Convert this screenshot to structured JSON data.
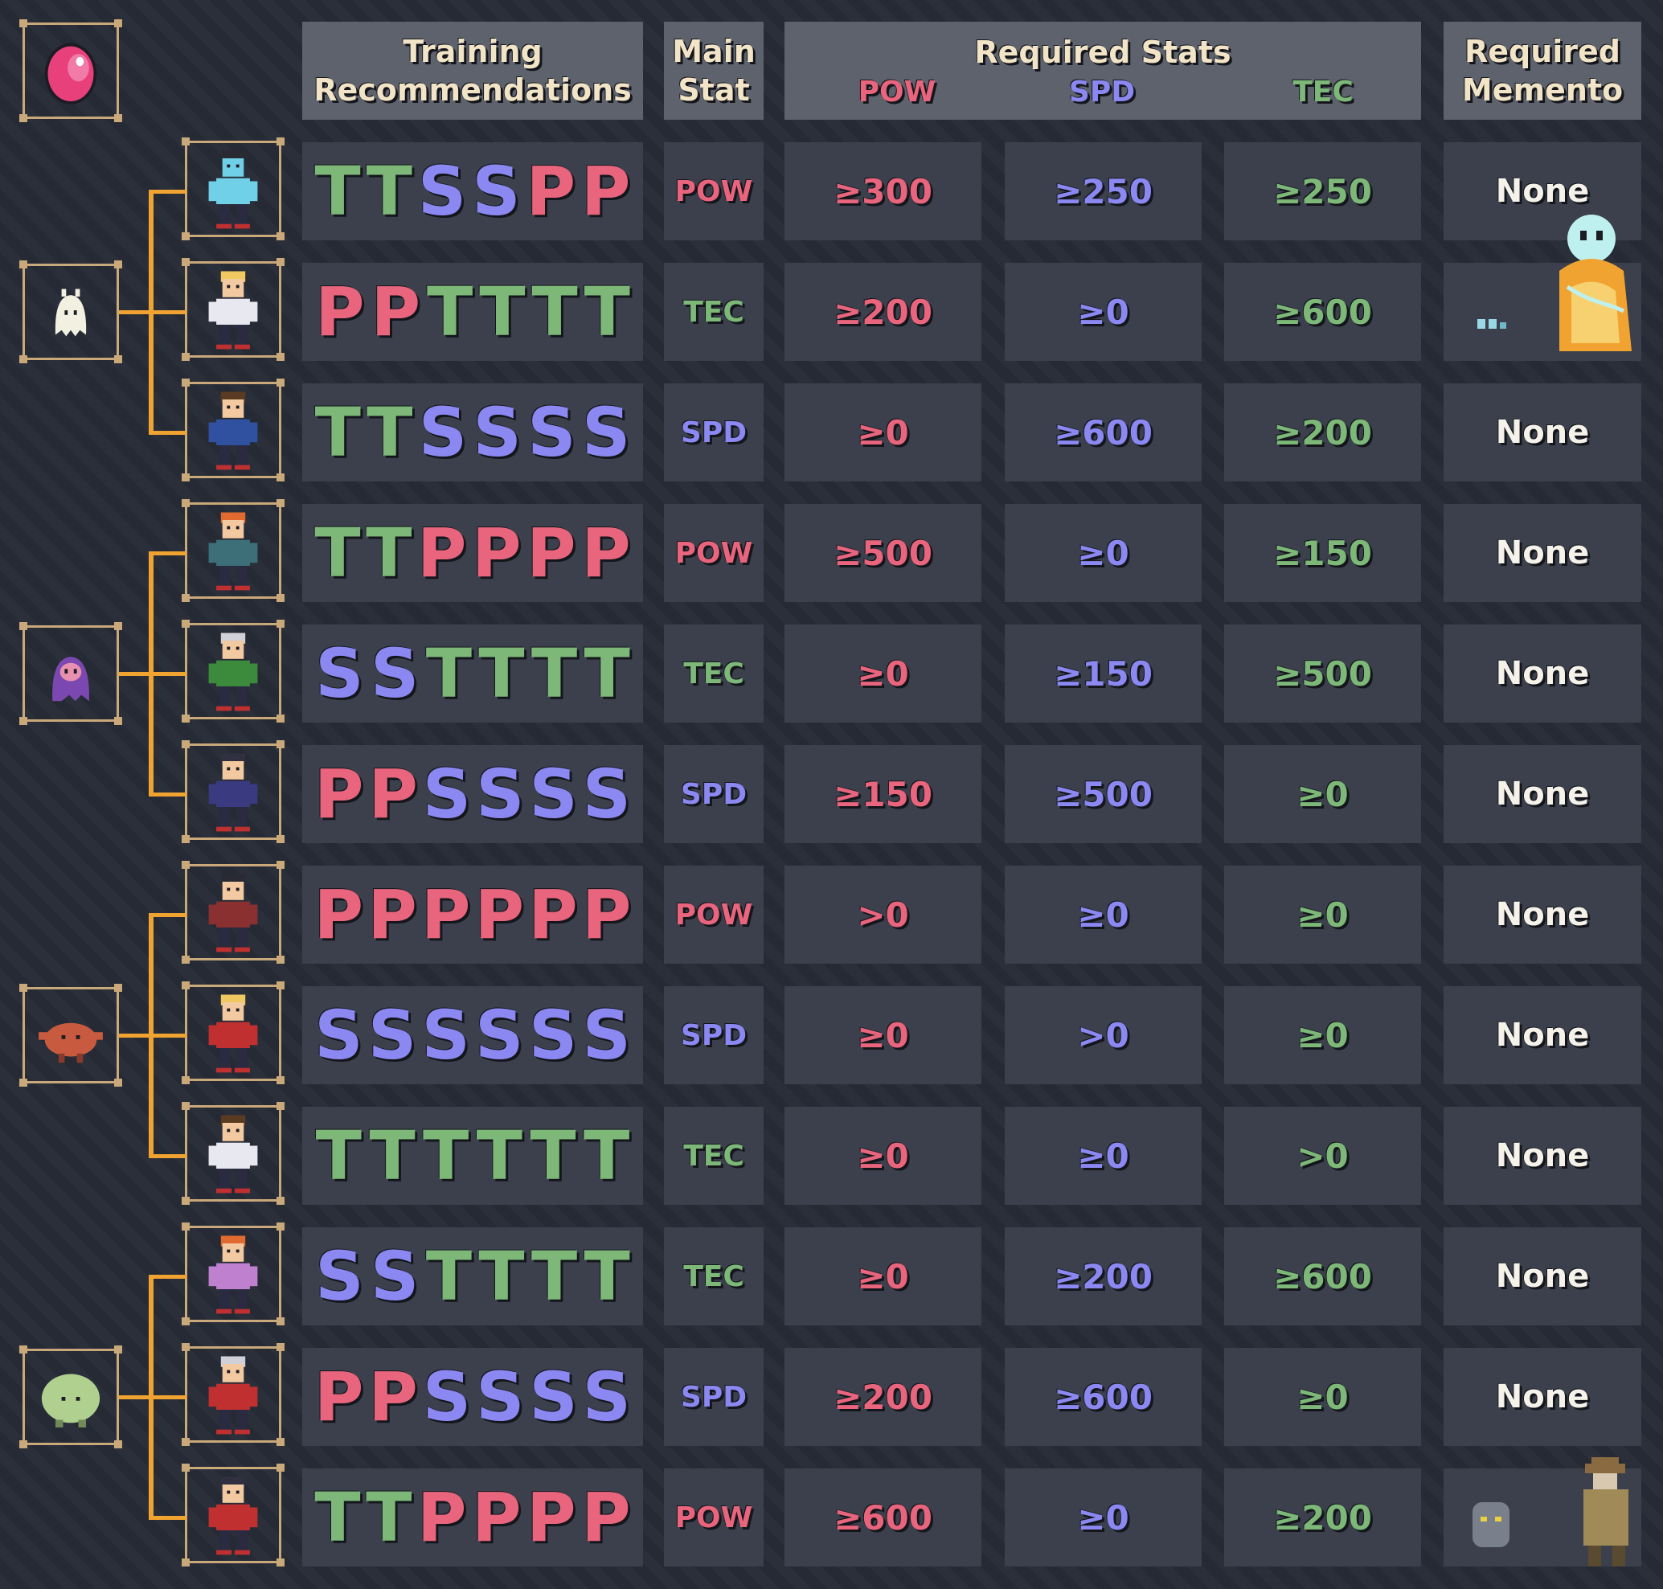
{
  "header": {
    "training": "Training\nRecommendations",
    "main_stat": "Main\nStat",
    "required_stats": "Required Stats",
    "pow": "POW",
    "spd": "SPD",
    "tec": "TEC",
    "memento": "Required\nMemento"
  },
  "icons": {
    "egg": "pink-egg-icon",
    "monsters": [
      "ghost-monster-icon",
      "purple-ghost-monster-icon",
      "crab-monster-icon",
      "green-blob-monster-icon"
    ]
  },
  "colors": {
    "POW": "#e8657d",
    "SPD": "#8b88f2",
    "TEC": "#7db879",
    "line": "#f0a330",
    "frame": "#c9a87a"
  },
  "rows": [
    {
      "letters": [
        "T",
        "T",
        "S",
        "S",
        "P",
        "P"
      ],
      "main": "POW",
      "pow": "≥300",
      "spd": "≥250",
      "tec": "≥250",
      "memento": "None"
    },
    {
      "letters": [
        "P",
        "P",
        "T",
        "T",
        "T",
        "T"
      ],
      "main": "TEC",
      "pow": "≥200",
      "spd": "≥0",
      "tec": "≥600",
      "memento": ""
    },
    {
      "letters": [
        "T",
        "T",
        "S",
        "S",
        "S",
        "S"
      ],
      "main": "SPD",
      "pow": "≥0",
      "spd": "≥600",
      "tec": "≥200",
      "memento": "None"
    },
    {
      "letters": [
        "T",
        "T",
        "P",
        "P",
        "P",
        "P"
      ],
      "main": "POW",
      "pow": "≥500",
      "spd": "≥0",
      "tec": "≥150",
      "memento": "None"
    },
    {
      "letters": [
        "S",
        "S",
        "T",
        "T",
        "T",
        "T"
      ],
      "main": "TEC",
      "pow": "≥0",
      "spd": "≥150",
      "tec": "≥500",
      "memento": "None"
    },
    {
      "letters": [
        "P",
        "P",
        "S",
        "S",
        "S",
        "S"
      ],
      "main": "SPD",
      "pow": "≥150",
      "spd": "≥500",
      "tec": "≥0",
      "memento": "None"
    },
    {
      "letters": [
        "P",
        "P",
        "P",
        "P",
        "P",
        "P"
      ],
      "main": "POW",
      "pow": ">0",
      "spd": "≥0",
      "tec": "≥0",
      "memento": "None"
    },
    {
      "letters": [
        "S",
        "S",
        "S",
        "S",
        "S",
        "S"
      ],
      "main": "SPD",
      "pow": "≥0",
      "spd": ">0",
      "tec": "≥0",
      "memento": "None"
    },
    {
      "letters": [
        "T",
        "T",
        "T",
        "T",
        "T",
        "T"
      ],
      "main": "TEC",
      "pow": "≥0",
      "spd": "≥0",
      "tec": ">0",
      "memento": "None"
    },
    {
      "letters": [
        "S",
        "S",
        "T",
        "T",
        "T",
        "T"
      ],
      "main": "TEC",
      "pow": "≥0",
      "spd": "≥200",
      "tec": "≥600",
      "memento": "None"
    },
    {
      "letters": [
        "P",
        "P",
        "S",
        "S",
        "S",
        "S"
      ],
      "main": "SPD",
      "pow": "≥200",
      "spd": "≥600",
      "tec": "≥0",
      "memento": "None"
    },
    {
      "letters": [
        "T",
        "T",
        "P",
        "P",
        "P",
        "P"
      ],
      "main": "POW",
      "pow": "≥600",
      "spd": "≥0",
      "tec": "≥200",
      "memento": ""
    }
  ]
}
